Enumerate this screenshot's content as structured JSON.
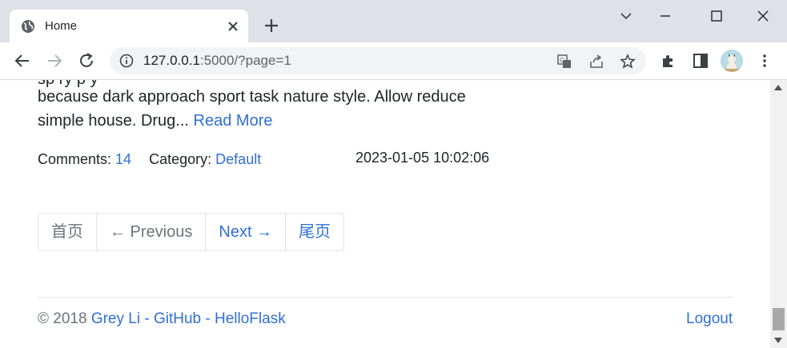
{
  "browser": {
    "tab": {
      "title": "Home"
    },
    "address": {
      "host": "127.0.0.1",
      "rest": ":5000/?page=1"
    }
  },
  "post": {
    "partial_line": "sp                                      ry p          y",
    "excerpt_text": "because dark approach sport task nature style. Allow reduce simple house. Drug...",
    "read_more": "Read More",
    "comments_label": "Comments:",
    "comments_count": "14",
    "category_label": "Category:",
    "category_name": "Default",
    "date": "2023-01-05 10:02:06"
  },
  "pagination": {
    "first": "首页",
    "previous": "← Previous",
    "next": "Next →",
    "last": "尾页"
  },
  "footer": {
    "copyright": "© 2018",
    "author": "Grey Li",
    "sep1": "-",
    "github": "GitHub",
    "sep2": "-",
    "helloflask": "HelloFlask",
    "logout": "Logout"
  }
}
